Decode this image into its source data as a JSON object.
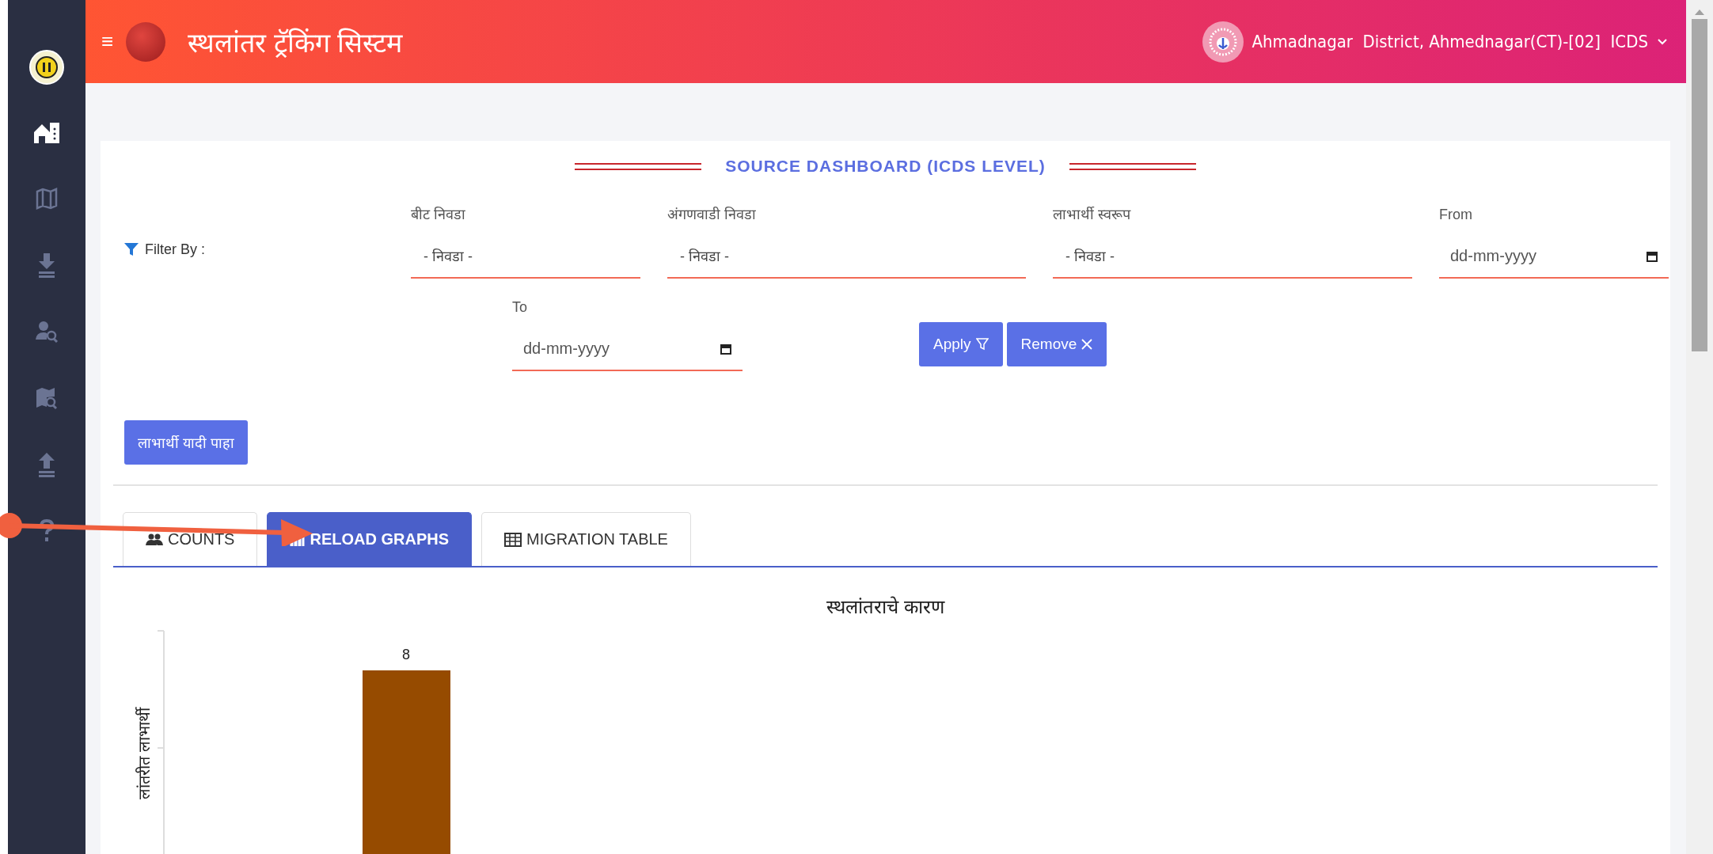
{
  "header": {
    "menu_icon": "≡",
    "title": "स्थलांतर ट्रॅकिंग सिस्टम",
    "user": "Ahmadnagar  District, Ahmednagar(CT)-[02]  ICDS"
  },
  "sidebar": {
    "items": [
      {
        "kind": "home",
        "selected": true
      },
      {
        "kind": "map",
        "selected": false
      },
      {
        "kind": "download",
        "selected": false
      },
      {
        "kind": "user-search",
        "selected": false
      },
      {
        "kind": "map-search",
        "selected": false
      },
      {
        "kind": "upload",
        "selected": false
      },
      {
        "kind": "help",
        "selected": false
      }
    ]
  },
  "dashboard": {
    "title": "SOURCE DASHBOARD (ICDS LEVEL)",
    "filter_label": "Filter By :",
    "filters": [
      {
        "kind": "select",
        "label": "बीट निवडा",
        "value": "- निवडा -"
      },
      {
        "kind": "select",
        "label": "अंगणवाडी निवडा",
        "value": "- निवडा -"
      },
      {
        "kind": "select",
        "label": "लाभार्थी स्वरूप",
        "value": "- निवडा -"
      },
      {
        "kind": "date",
        "label": "From",
        "placeholder": "dd-mm-yyyy"
      },
      {
        "kind": "date",
        "label": "To",
        "placeholder": "dd-mm-yyyy"
      }
    ],
    "buttons": [
      {
        "kind": "apply",
        "label": "Apply"
      },
      {
        "kind": "remove",
        "label": "Remove"
      }
    ],
    "list_button": "लाभार्थी यादी पाहा"
  },
  "tabs": [
    {
      "kind": "counts",
      "label": "COUNTS",
      "selected": false
    },
    {
      "kind": "graphs",
      "label": "RELOAD GRAPHS",
      "selected": true
    },
    {
      "kind": "table",
      "label": "MIGRATION TABLE",
      "selected": false
    }
  ],
  "chart": {
    "title": "स्थलांतराचे कारण",
    "axis_label": "लांतरीत लाभार्थी",
    "bar_label": "8"
  }
}
